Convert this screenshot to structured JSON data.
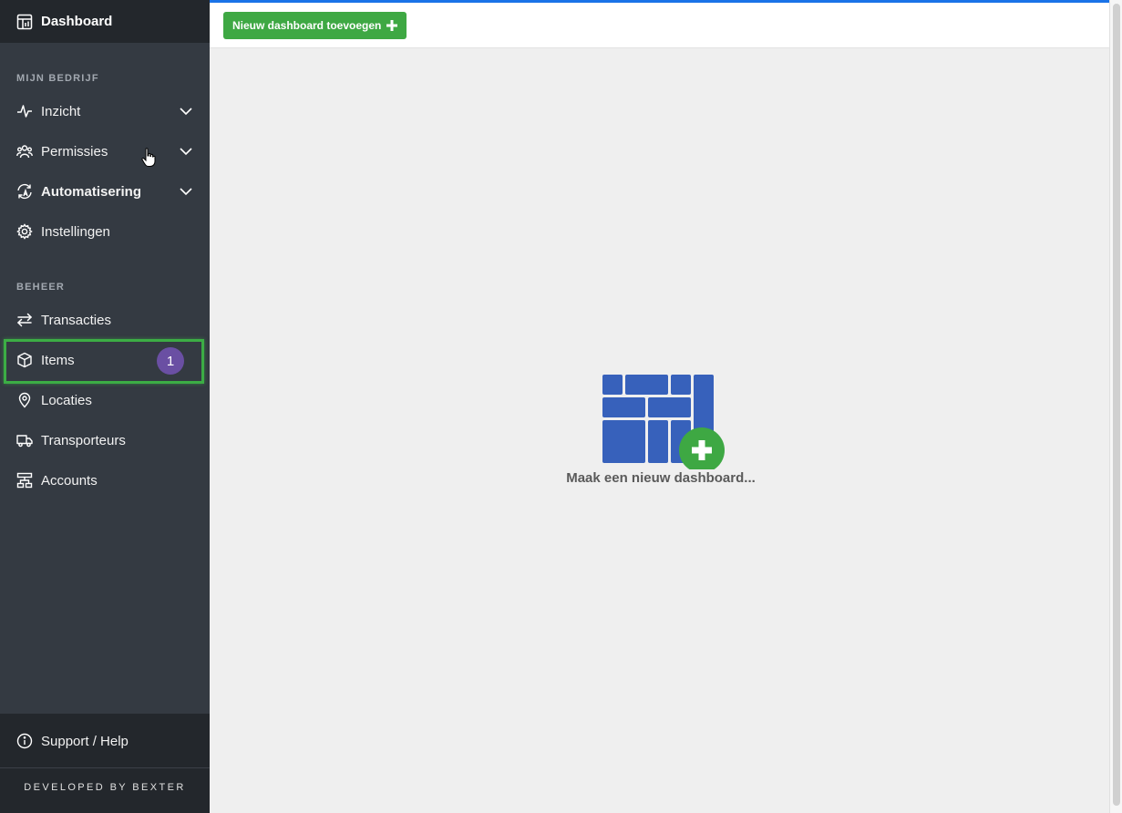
{
  "sidebar": {
    "dashboard": {
      "label": "Dashboard",
      "icon": "dashboard-icon"
    },
    "section_company": "MIJN BEDRIJF",
    "company_items": [
      {
        "label": "Inzicht",
        "icon": "activity-icon",
        "expandable": true
      },
      {
        "label": "Permissies",
        "icon": "users-icon",
        "expandable": true
      },
      {
        "label": "Automatisering",
        "icon": "automation-icon",
        "expandable": true
      },
      {
        "label": "Instellingen",
        "icon": "gear-icon",
        "expandable": false
      }
    ],
    "section_manage": "BEHEER",
    "manage_items": [
      {
        "label": "Transacties",
        "icon": "arrows-icon"
      },
      {
        "label": "Items",
        "icon": "box-icon",
        "badge": "1",
        "highlighted": true
      },
      {
        "label": "Locaties",
        "icon": "location-pin-icon"
      },
      {
        "label": "Transporteurs",
        "icon": "truck-icon"
      },
      {
        "label": "Accounts",
        "icon": "accounts-icon"
      }
    ],
    "support": {
      "label": "Support / Help",
      "icon": "info-icon"
    },
    "footer": "DEVELOPED BY BEXTER"
  },
  "toolbar": {
    "add_dashboard_label": "Nieuw dashboard toevoegen"
  },
  "main": {
    "empty_state_caption": "Maak een nieuw dashboard..."
  },
  "colors": {
    "sidebar_bg": "#343a42",
    "sidebar_dark": "#23272c",
    "accent_green": "#3ea843",
    "badge_purple": "#6a4fa3",
    "tile_blue": "#3761bb",
    "top_line_blue": "#1a73e8"
  }
}
